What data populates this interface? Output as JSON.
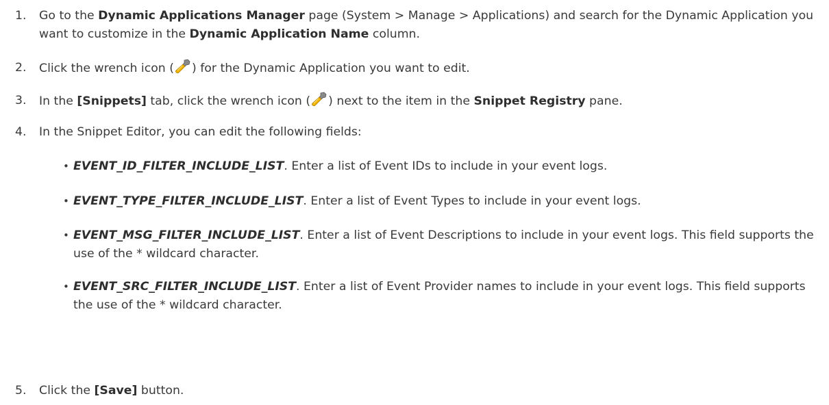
{
  "steps": [
    {
      "num": "1.",
      "t1": "Go to the ",
      "b1": "Dynamic Applications Manager",
      "t2": " page (System > Manage > Applications) and search for the Dynamic Application you want to customize in the ",
      "b2": "Dynamic Application Name",
      "t3": " column."
    },
    {
      "num": "2.",
      "t1": "Click the wrench icon (",
      "t2": ") for the Dynamic Application you want to edit."
    },
    {
      "num": "3.",
      "t1": "In the ",
      "b1": "[Snippets]",
      "t2": " tab, click the wrench icon (",
      "t3": ") next to the item in the ",
      "b2": "Snippet Registry",
      "t4": " pane."
    },
    {
      "num": "4.",
      "t1": "In the Snippet Editor, you can edit the following fields:"
    },
    {
      "num": "5.",
      "t1": "Click the ",
      "b1": "[Save]",
      "t2": " button."
    }
  ],
  "bullets": [
    {
      "field": "EVENT_ID_FILTER_INCLUDE_LIST",
      "text": ". Enter a list of Event IDs to include in your event logs."
    },
    {
      "field": "EVENT_TYPE_FILTER_INCLUDE_LIST",
      "text": ". Enter a list of Event Types to include in your event logs."
    },
    {
      "field": "EVENT_MSG_FILTER_INCLUDE_LIST",
      "text": ". Enter a list of Event Descriptions to include in your event logs. This field supports the use of the * wildcard character."
    },
    {
      "field": "EVENT_SRC_FILTER_INCLUDE_LIST",
      "text": ". Enter a list of Event Provider names to include in your event logs. This field supports the use of the * wildcard character."
    }
  ],
  "bullet_glyph": "•",
  "icons": {
    "wrench": "wrench-icon"
  },
  "colors": {
    "text": "#3a3a3a",
    "wrench_head": "#7a7a7a",
    "wrench_handle": "#f2b400"
  }
}
